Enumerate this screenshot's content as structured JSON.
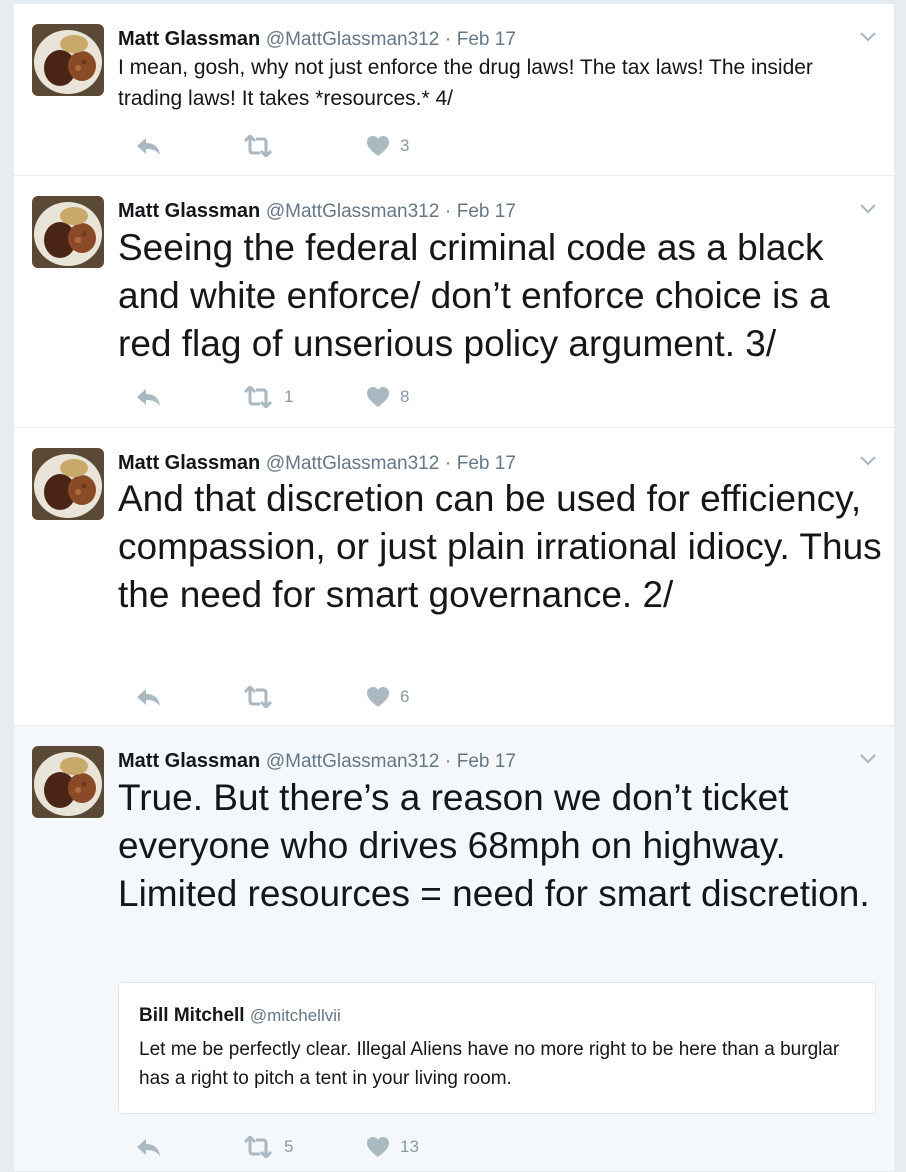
{
  "tweets": [
    {
      "name": "Matt Glassman",
      "handle": "@MattGlassman312",
      "separator": "·",
      "date": "Feb 17",
      "text": "I mean, gosh, why not just enforce the drug laws! The tax laws! The insider trading laws! It takes *resources.* 4/",
      "retweets": "",
      "likes": "3"
    },
    {
      "name": "Matt Glassman",
      "handle": "@MattGlassman312",
      "separator": "·",
      "date": "Feb 17",
      "text": "Seeing the federal criminal code as a black and white enforce/ don’t enforce choice is a red flag of unserious policy argument. 3/",
      "retweets": "1",
      "likes": "8"
    },
    {
      "name": "Matt Glassman",
      "handle": "@MattGlassman312",
      "separator": "·",
      "date": "Feb 17",
      "text": "And that discretion can be used for efficiency, compassion, or just plain irrational idiocy. Thus the need for smart governance. 2/",
      "retweets": "",
      "likes": "6"
    },
    {
      "name": "Matt Glassman",
      "handle": "@MattGlassman312",
      "separator": "·",
      "date": "Feb 17",
      "text": "True. But there’s a reason we don’t ticket everyone who drives 68mph on highway. Limited resources = need for smart discretion.",
      "retweets": "5",
      "likes": "13",
      "quote": {
        "name": "Bill Mitchell",
        "handle": "@mitchellvii",
        "text": "Let me be perfectly clear. Illegal Aliens have no more right to be here than a burglar has a right to pitch a tent in your living room."
      }
    }
  ],
  "icons": {
    "reply": "reply-icon",
    "retweet": "retweet-icon",
    "like": "heart-icon",
    "caret": "chevron-down-icon",
    "avatar": "avatar-food-plate"
  },
  "colors": {
    "action_gray": "#aab8c2",
    "secondary_text": "#657786",
    "background": "#e6ecf0"
  }
}
